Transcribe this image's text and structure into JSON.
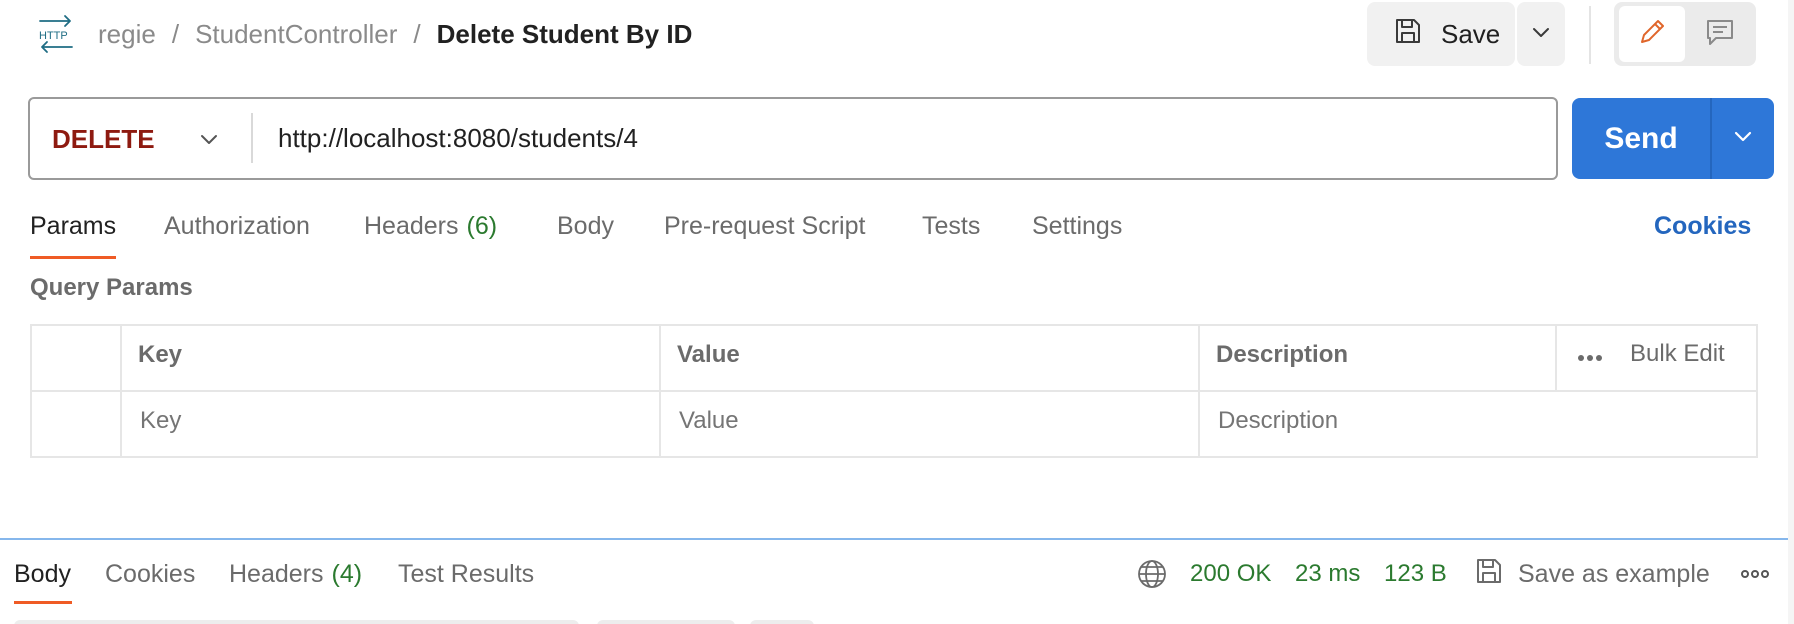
{
  "header": {
    "http_icon_label": "HTTP",
    "breadcrumb": [
      "regie",
      "StudentController",
      "Delete Student By ID"
    ],
    "save_label": "Save"
  },
  "request": {
    "method": "DELETE",
    "url": "http://localhost:8080/students/4",
    "send_label": "Send"
  },
  "request_tabs": [
    {
      "label": "Params",
      "count": ""
    },
    {
      "label": "Authorization",
      "count": ""
    },
    {
      "label": "Headers",
      "count": "(6)"
    },
    {
      "label": "Body",
      "count": ""
    },
    {
      "label": "Pre-request Script",
      "count": ""
    },
    {
      "label": "Tests",
      "count": ""
    },
    {
      "label": "Settings",
      "count": ""
    }
  ],
  "cookies_label": "Cookies",
  "query_params": {
    "title": "Query Params",
    "columns": [
      "Key",
      "Value",
      "Description"
    ],
    "bulk_edit_label": "Bulk Edit",
    "placeholders": {
      "key": "Key",
      "value": "Value",
      "description": "Description"
    }
  },
  "response": {
    "tabs": [
      {
        "label": "Body",
        "count": ""
      },
      {
        "label": "Cookies",
        "count": ""
      },
      {
        "label": "Headers",
        "count": "(4)"
      },
      {
        "label": "Test Results",
        "count": ""
      }
    ],
    "status": "200 OK",
    "time": "23 ms",
    "size": "123 B",
    "save_example_label": "Save as example"
  },
  "colors": {
    "accent": "#2e77d8",
    "method_delete": "#8e1a10",
    "active_tab_underline": "#ef5b25",
    "success": "#2b7a2f",
    "link": "#2466be"
  },
  "icons": [
    "http-icon",
    "save-icon",
    "chevron-down-icon",
    "pencil-icon",
    "comment-icon",
    "more-horizontal-icon",
    "globe-icon"
  ]
}
